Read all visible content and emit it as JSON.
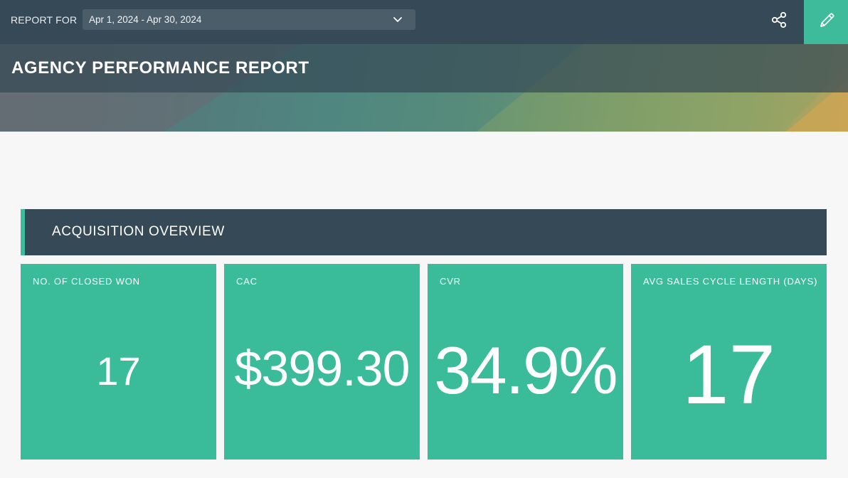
{
  "toolbar": {
    "report_for_label": "REPORT FOR",
    "date_range": "Apr 1, 2024 - Apr 30, 2024",
    "share_icon": "share-icon",
    "edit_icon": "pencil-icon",
    "accent_color": "#3dbb9a"
  },
  "banner": {
    "title": "AGENCY PERFORMANCE REPORT"
  },
  "section": {
    "title": "ACQUISITION OVERVIEW"
  },
  "kpis": [
    {
      "label": "NO. OF CLOSED WON",
      "value": "17"
    },
    {
      "label": "CAC",
      "value": "$399.30"
    },
    {
      "label": "CVR",
      "value": "34.9%"
    },
    {
      "label": "AVG SALES CYCLE LENGTH (DAYS)",
      "value": "17"
    }
  ],
  "colors": {
    "header_bg": "#364956",
    "tile_bg": "#3abb9a",
    "page_bg": "#f7f7f7"
  }
}
